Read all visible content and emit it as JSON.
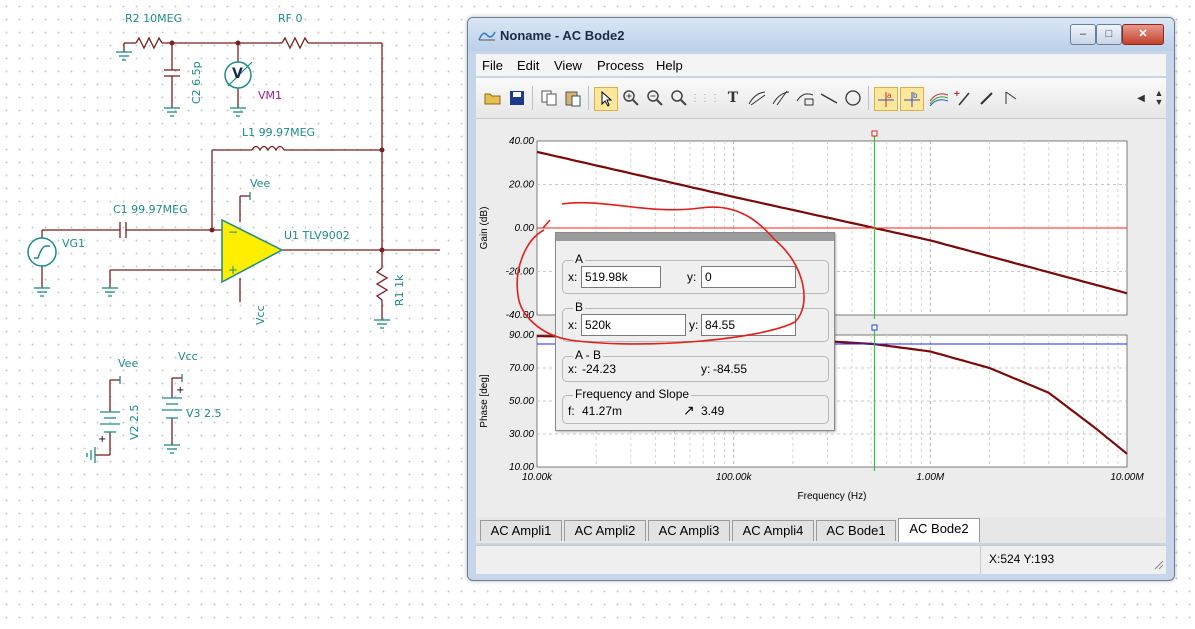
{
  "schematic": {
    "r2_label": "R2 10MEG",
    "rf_label": "RF 0",
    "c2_label": "C2 6.5p",
    "vm1_label": "VM1",
    "vm_symbol": "V",
    "l1_label": "L1 99.97MEG",
    "vee_label_top": "Vee",
    "c1_label": "C1 99.97MEG",
    "u1_label": "U1 TLV9002",
    "vg1_label": "VG1",
    "r1_label": "R1 1k",
    "vcc_label_opamp": "Vcc",
    "vee_label_supply": "Vee",
    "vcc_label_supply": "Vcc",
    "v2_label": "V2 2.5",
    "v3_label": "V3 2.5"
  },
  "window": {
    "title": "Noname - AC Bode2",
    "minimize": "–",
    "maximize": "□",
    "close": "✕"
  },
  "menu": {
    "file": "File",
    "edit": "Edit",
    "view": "View",
    "process": "Process",
    "help": "Help"
  },
  "toolbar": {
    "text_tool": "T",
    "icons": [
      "open-icon",
      "save-icon",
      "copy-icon",
      "paste-icon",
      "pointer-icon",
      "zoom-in-icon",
      "zoom-out-icon",
      "zoom-100-icon",
      "grid-icon",
      "text-icon",
      "slope-icon",
      "slope2-icon",
      "axis-icon",
      "line-icon",
      "circle-icon",
      "cursor-a-icon",
      "cursor-b-icon",
      "curves-icon",
      "marker-icon",
      "picker-icon",
      "arrow-icon",
      "scroll-left-icon",
      "spin-icon"
    ]
  },
  "chart_data": [
    {
      "type": "line",
      "ylabel": "Gain (dB)",
      "ylim": [
        -40,
        40
      ],
      "y_ticks": [
        "40.00",
        "20.00",
        "0.00",
        "-20.00",
        "-40.00"
      ],
      "xscale": "log",
      "xlim": [
        10000,
        10000000
      ],
      "series": [
        {
          "color": "#7a0a0a",
          "x": [
            10000,
            100000,
            520000,
            1000000,
            10000000
          ],
          "y": [
            35,
            14.3,
            0,
            -5.7,
            -30
          ]
        },
        {
          "color": "#ff2020",
          "x": [
            10000,
            10000000
          ],
          "y": [
            0,
            0
          ]
        }
      ],
      "cursor_x": 519980
    },
    {
      "type": "line",
      "ylabel": "Phase [deg]",
      "ylim": [
        10,
        90
      ],
      "y_ticks": [
        "90.00",
        "70.00",
        "50.00",
        "30.00",
        "10.00"
      ],
      "xlabel": "Frequency (Hz)",
      "x_ticks": [
        "10.00k",
        "100.00k",
        "1.00M",
        "10.00M"
      ],
      "xscale": "log",
      "xlim": [
        10000,
        10000000
      ],
      "series": [
        {
          "color": "#7a0a0a",
          "x": [
            10000,
            100000,
            300000,
            520000,
            1000000,
            2000000,
            4000000,
            7000000,
            10000000
          ],
          "y": [
            89.3,
            88,
            86.2,
            84.5,
            80,
            70,
            55,
            33,
            18
          ]
        },
        {
          "color": "#2020ff",
          "x": [
            10000,
            10000000
          ],
          "y": [
            84.55,
            84.55
          ]
        }
      ],
      "cursor_x": 520000
    }
  ],
  "cursor_dialog": {
    "group_a": "A",
    "group_b": "B",
    "group_ab": "A - B",
    "group_fs": "Frequency and Slope",
    "x_label": "x:",
    "y_label": "y:",
    "f_label": "f:",
    "a_x": "519.98k",
    "a_y": "0",
    "b_x": "520k",
    "b_y": "84.55",
    "ab_x": "-24.23",
    "ab_y": "-84.55",
    "f_value": "41.27m",
    "slope_symbol": "↗",
    "slope_value": "3.49"
  },
  "tabs": [
    "AC Ampli1",
    "AC Ampli2",
    "AC Ampli3",
    "AC Ampli4",
    "AC Bode1",
    "AC Bode2"
  ],
  "status": {
    "coords": "X:524  Y:193"
  }
}
